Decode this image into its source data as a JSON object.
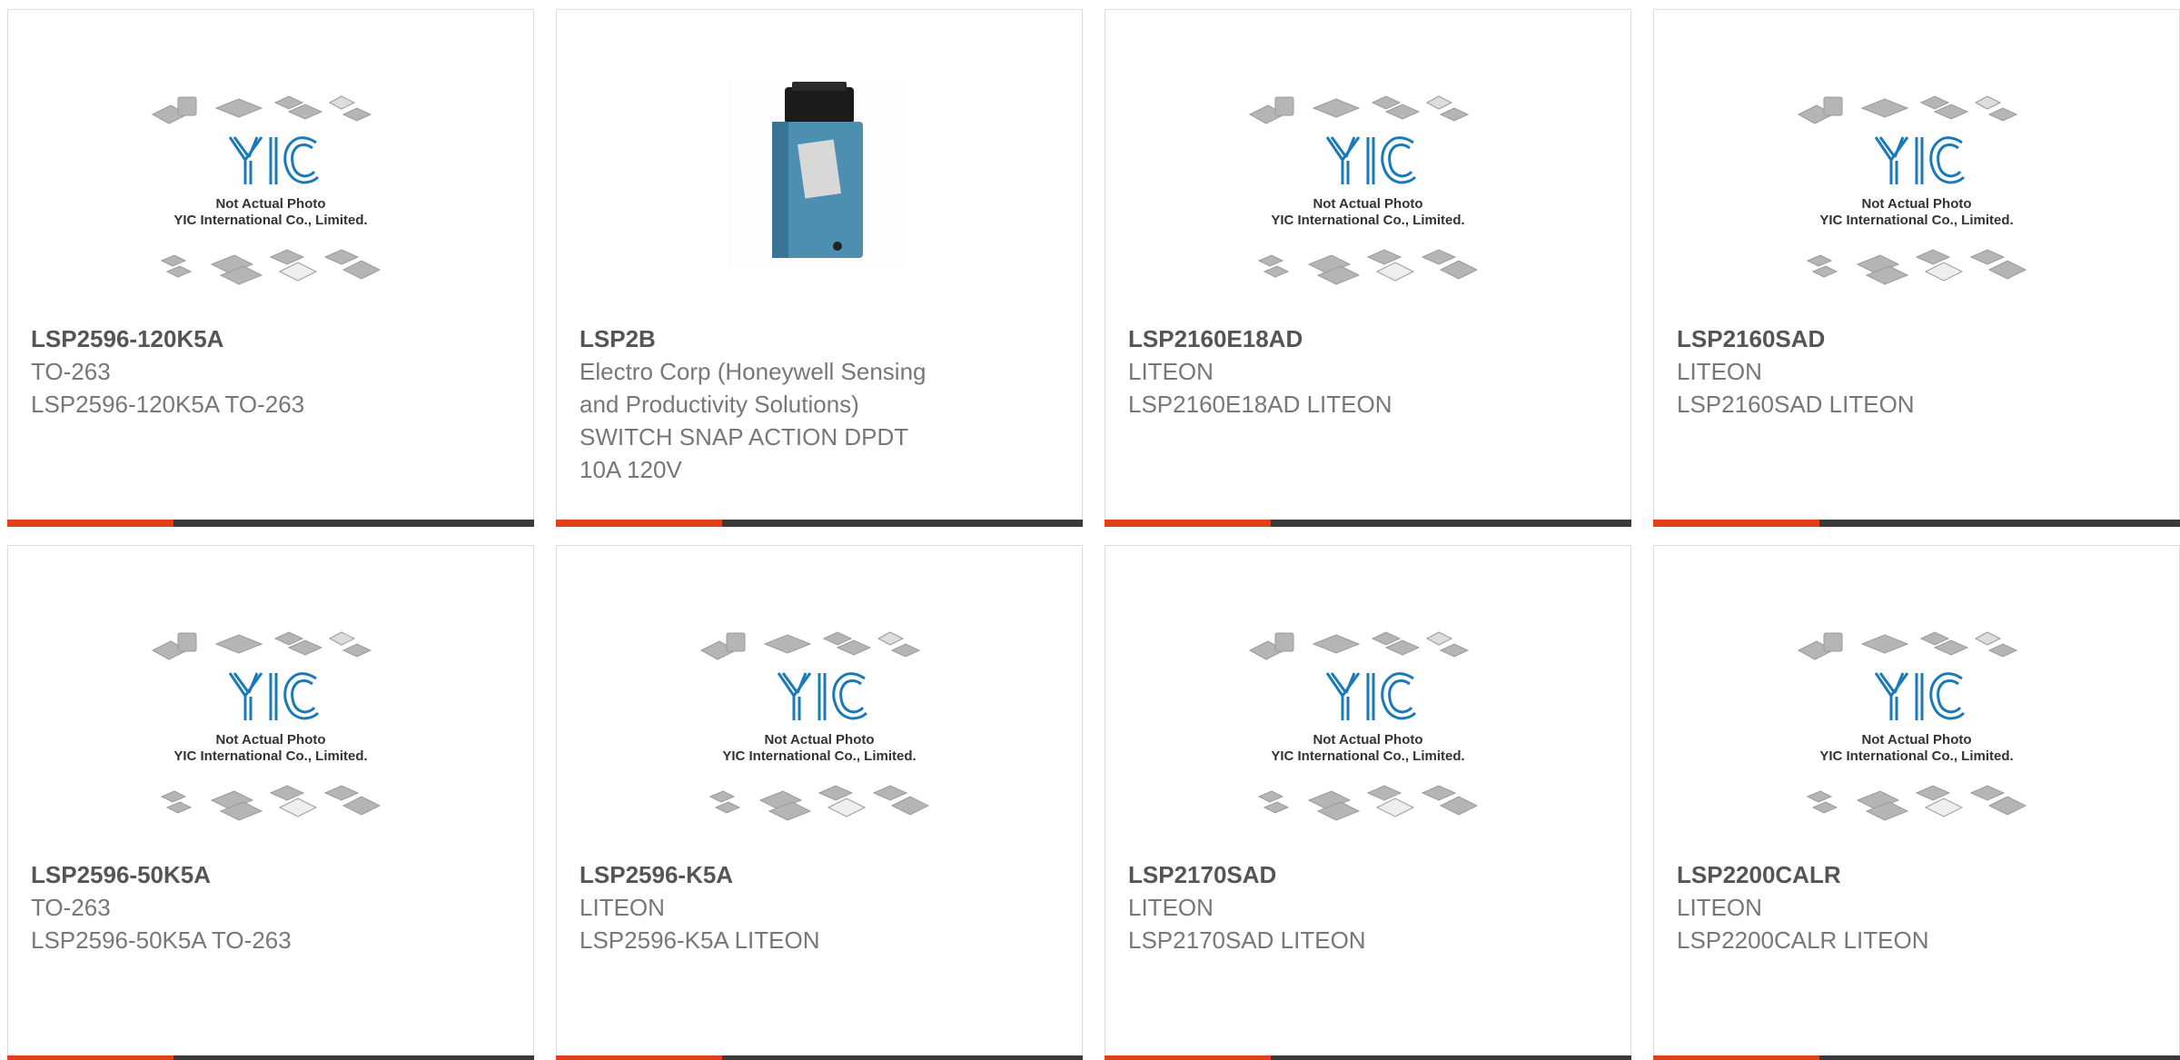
{
  "placeholder": {
    "logo_text": "YIC",
    "caption1": "Not Actual Photo",
    "caption2": "YIC International Co., Limited."
  },
  "products": [
    {
      "name": "LSP2596-120K5A",
      "lines": [
        "TO-263",
        "LSP2596-120K5A TO-263"
      ],
      "image": "placeholder"
    },
    {
      "name": "LSP2B",
      "lines": [
        "Electro Corp (Honeywell Sensing",
        "and Productivity Solutions)",
        "SWITCH SNAP ACTION DPDT",
        "10A 120V"
      ],
      "image": "limit-switch-photo"
    },
    {
      "name": "LSP2160E18AD",
      "lines": [
        "LITEON",
        "LSP2160E18AD LITEON"
      ],
      "image": "placeholder"
    },
    {
      "name": "LSP2160SAD",
      "lines": [
        "LITEON",
        "LSP2160SAD LITEON"
      ],
      "image": "placeholder"
    },
    {
      "name": "LSP2596-50K5A",
      "lines": [
        "TO-263",
        "LSP2596-50K5A TO-263"
      ],
      "image": "placeholder"
    },
    {
      "name": "LSP2596-K5A",
      "lines": [
        "LITEON",
        "LSP2596-K5A LITEON"
      ],
      "image": "placeholder"
    },
    {
      "name": "LSP2170SAD",
      "lines": [
        "LITEON",
        "LSP2170SAD LITEON"
      ],
      "image": "placeholder"
    },
    {
      "name": "LSP2200CALR",
      "lines": [
        "LITEON",
        "LSP2200CALR LITEON"
      ],
      "image": "placeholder"
    }
  ],
  "colors": {
    "accent": "#e0401a",
    "bar": "#3a3a3a",
    "logo": "#1a7ab8"
  }
}
